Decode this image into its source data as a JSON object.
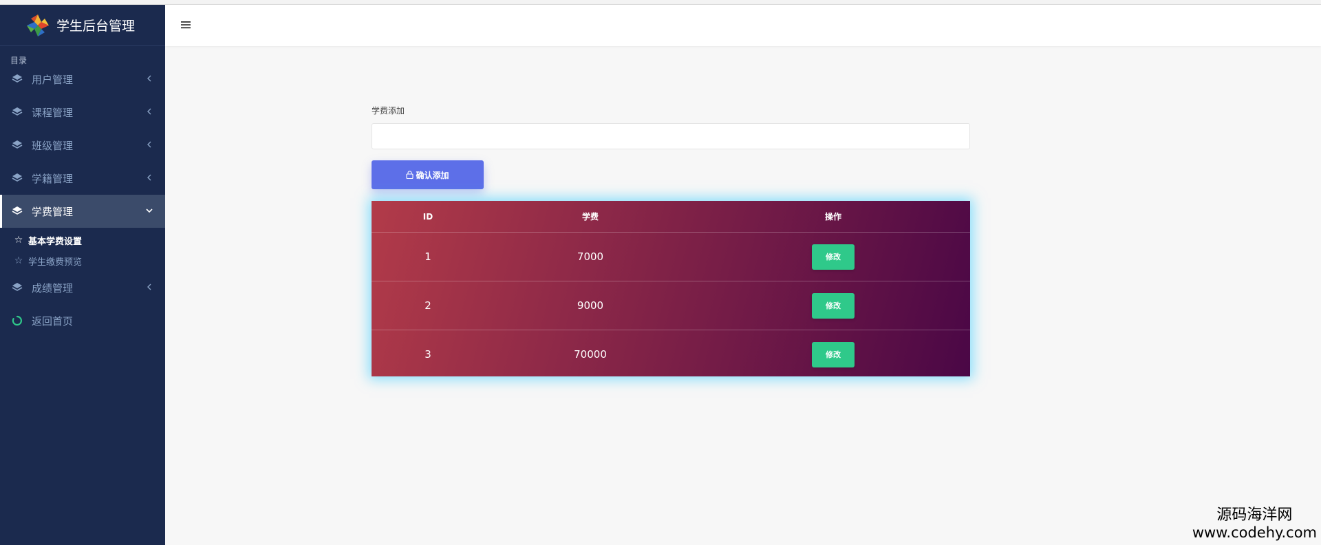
{
  "sidebar": {
    "brand": "学生后台管理",
    "section_label": "目录",
    "menu": [
      {
        "label": "用户管理"
      },
      {
        "label": "课程管理"
      },
      {
        "label": "班级管理"
      },
      {
        "label": "学籍管理"
      },
      {
        "label": "学费管理",
        "active": true
      }
    ],
    "submenu": [
      {
        "label": "基本学费设置",
        "active": true
      },
      {
        "label": "学生缴费预览"
      }
    ],
    "grades": {
      "label": "成绩管理"
    },
    "home": {
      "label": "返回首页"
    }
  },
  "form": {
    "label": "学费添加",
    "input_value": "",
    "button_label": "确认添加"
  },
  "table": {
    "headers": [
      "ID",
      "学费",
      "操作"
    ],
    "rows": [
      {
        "id": "1",
        "fee": "7000",
        "action": "修改"
      },
      {
        "id": "2",
        "fee": "9000",
        "action": "修改"
      },
      {
        "id": "3",
        "fee": "70000",
        "action": "修改"
      }
    ]
  },
  "watermark": {
    "text_cn": "源码海洋网",
    "url": "www.codehy.com"
  },
  "colors": {
    "sidebar_bg": "#1b2a4e",
    "accent_button": "#5d6fe8",
    "edit_button": "#2fc98a",
    "table_gradient_start": "#b23b49",
    "table_gradient_end": "#4a0746",
    "table_glow": "#28c8ff"
  },
  "icons": {
    "layers": "layers-icon",
    "chevron_left": "chevron-left-icon",
    "chevron_down": "chevron-down-icon",
    "star": "star-icon",
    "loading_circle": "loading-circle-icon",
    "menu": "hamburger-menu-icon",
    "lock": "lock-icon"
  }
}
